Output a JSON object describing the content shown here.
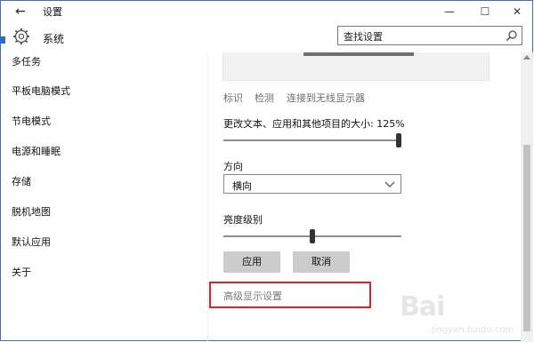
{
  "titlebar": {
    "back_glyph": "←",
    "title": "设置",
    "minimize_glyph": "—",
    "maximize_glyph": "☐",
    "close_glyph": "✕"
  },
  "header": {
    "title": "系统",
    "search_text": "查找设置"
  },
  "sidebar": {
    "items": [
      {
        "label": "多任务"
      },
      {
        "label": "平板电脑模式"
      },
      {
        "label": "节电模式"
      },
      {
        "label": "电源和睡眠"
      },
      {
        "label": "存储"
      },
      {
        "label": "脱机地图"
      },
      {
        "label": "默认应用"
      },
      {
        "label": "关于"
      }
    ]
  },
  "display": {
    "links": [
      "标识",
      "检测",
      "连接到无线显示器"
    ],
    "scale_label": "更改文本、应用和其他项目的大小: 125%",
    "scale_level": 1.0,
    "orientation_label": "方向",
    "orientation_value": "横向",
    "brightness_label": "亮度级别",
    "brightness_level": 0.5,
    "apply_label": "应用",
    "cancel_label": "取消",
    "advanced_link": "高级显示设置"
  },
  "watermark": {
    "brand": "Bai",
    "site": "jingyan.baidu.com"
  },
  "colors": {
    "highlight_box": "#e02020",
    "button_bg": "#cccccc",
    "window_border": "#3f6fb5"
  }
}
